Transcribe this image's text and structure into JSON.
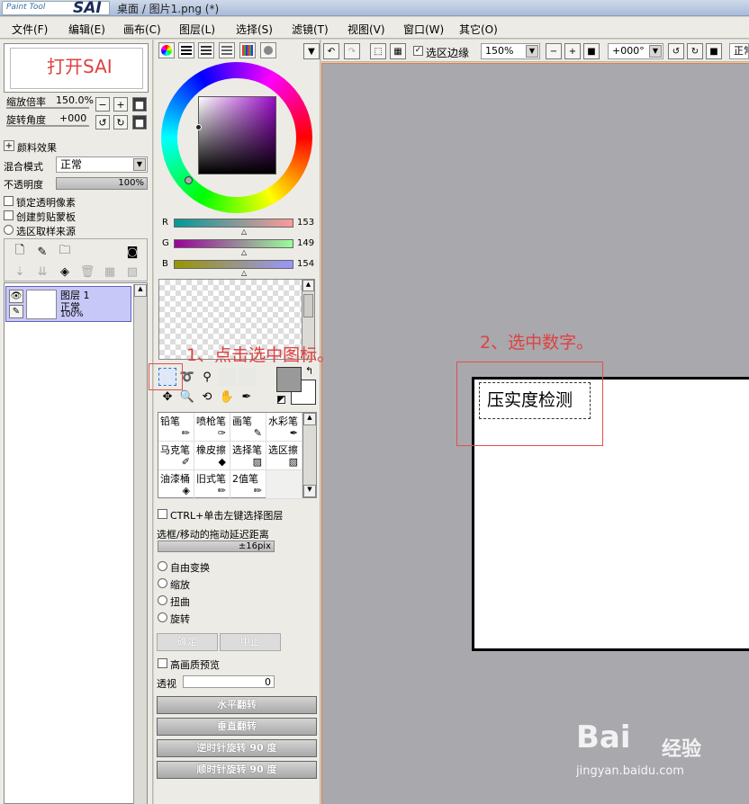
{
  "titlebar": {
    "logo_small": "Paint Tool",
    "logo_big": "SAI",
    "title": "桌面 / 图片1.png (*)"
  },
  "menu": [
    "文件(F)",
    "编辑(E)",
    "画布(C)",
    "图层(L)",
    "选择(S)",
    "滤镜(T)",
    "视图(V)",
    "窗口(W)",
    "其它(O)"
  ],
  "navigator": {
    "preview_text": "打开SAI",
    "zoom_label": "缩放倍率",
    "zoom_value": "150.0%",
    "rotate_label": "旋转角度",
    "rotate_value": "+000"
  },
  "layer_props": {
    "section": "颜料效果",
    "blend_label": "混合模式",
    "blend_value": "正常",
    "opacity_label": "不透明度",
    "opacity_value": "100%",
    "lock_alpha": "锁定透明像素",
    "clipping": "创建剪贴蒙板",
    "sample_source": "选区取样来源"
  },
  "layers": [
    {
      "name": "图层 1",
      "mode": "正常",
      "opacity": "100%"
    }
  ],
  "color": {
    "r_label": "R",
    "g_label": "G",
    "b_label": "B",
    "r": "153",
    "g": "149",
    "b": "154",
    "foreground": "#999599"
  },
  "brushes": [
    [
      "铅笔",
      "喷枪笔",
      "画笔",
      "水彩笔"
    ],
    [
      "马克笔",
      "橡皮擦",
      "选择笔",
      "选区擦"
    ],
    [
      "油漆桶",
      "旧式笔",
      "2值笔",
      ""
    ]
  ],
  "tool_options": {
    "ctrl_click": "CTRL+单击左键选择图层",
    "drag_label": "选框/移动的拖动延迟距离",
    "drag_value": "±16pix",
    "free_transform": "自由变换",
    "scale": "缩放",
    "distort": "扭曲",
    "rotate": "旋转",
    "ok": "确定",
    "cancel": "中止",
    "hq_preview": "高画质预览",
    "perspective_label": "透视",
    "perspective_value": "0",
    "flip_h": "水平翻转",
    "flip_v": "垂直翻转",
    "rot_ccw": "逆时针旋转 90 度",
    "rot_cw": "顺时针旋转 90 度"
  },
  "toolbar": {
    "show_selection": "选区边缘",
    "zoom": "150%",
    "angle": "+000°",
    "mode": "正常"
  },
  "canvas": {
    "text": "压实度检测",
    "annotation_1": "1、点击选中图标。",
    "annotation_2": "2、选中数字。"
  },
  "watermark": {
    "brand": "Bai",
    "brand2": "经验",
    "url": "jingyan.baidu.com"
  },
  "colors": {
    "accent_red": "#e04040",
    "layer_selected": "#c8c8f8",
    "canvas_bg": "#a9a8ac"
  }
}
